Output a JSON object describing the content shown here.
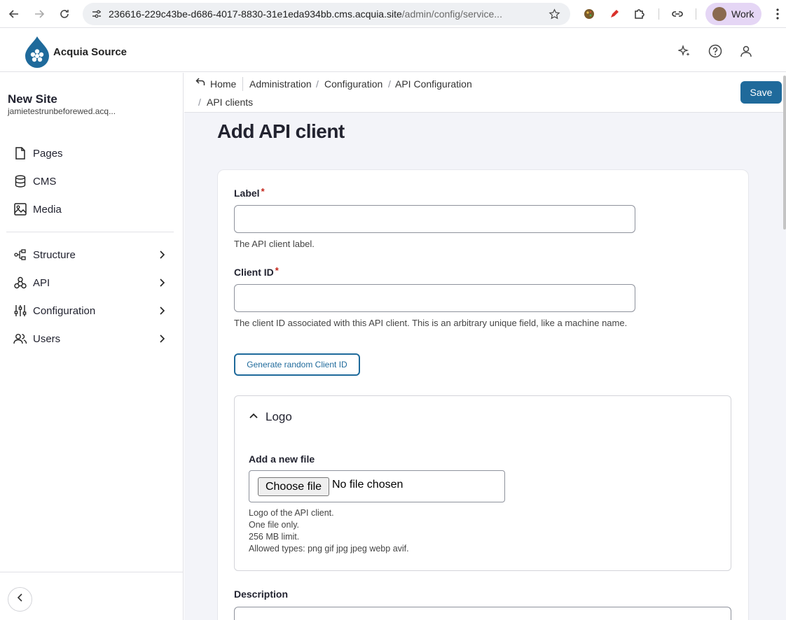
{
  "browser": {
    "url_host": "236616-229c43be-d686-4017-8830-31e1eda934bb.cms.acquia.site",
    "url_path": "/admin/config/service...",
    "profile_label": "Work"
  },
  "app": {
    "brand": "Acquia Source"
  },
  "sidebar": {
    "site_name": "New Site",
    "site_url": "jamietestrunbeforewed.acq...",
    "items": [
      {
        "label": "Pages",
        "icon": "page-icon"
      },
      {
        "label": "CMS",
        "icon": "database-icon"
      },
      {
        "label": "Media",
        "icon": "image-icon"
      },
      {
        "label": "Structure",
        "icon": "structure-icon"
      },
      {
        "label": "API",
        "icon": "api-icon"
      },
      {
        "label": "Configuration",
        "icon": "sliders-icon"
      },
      {
        "label": "Users",
        "icon": "users-icon"
      }
    ]
  },
  "breadcrumb": {
    "home": "Home",
    "items": [
      "Administration",
      "Configuration",
      "API Configuration",
      "API clients"
    ]
  },
  "toolbar": {
    "save_label": "Save"
  },
  "page": {
    "title": "Add API client"
  },
  "form": {
    "label": {
      "label": "Label",
      "required": "*",
      "value": "",
      "help": "The API client label."
    },
    "client_id": {
      "label": "Client ID",
      "required": "*",
      "value": "",
      "help": "The client ID associated with this API client. This is an arbitrary unique field, like a machine name."
    },
    "generate_button": "Generate random Client ID",
    "logo": {
      "summary": "Logo",
      "file_label": "Add a new file",
      "choose_button": "Choose file",
      "no_file": "No file chosen",
      "help_lines": [
        "Logo of the API client.",
        "One file only.",
        "256 MB limit.",
        "Allowed types: png gif jpg jpeg webp avif."
      ]
    },
    "description": {
      "label": "Description"
    }
  },
  "colors": {
    "primary": "#1f6a9b",
    "required": "#c4251a",
    "background": "#f3f4f9",
    "profile_chip": "#e5d6f5"
  }
}
